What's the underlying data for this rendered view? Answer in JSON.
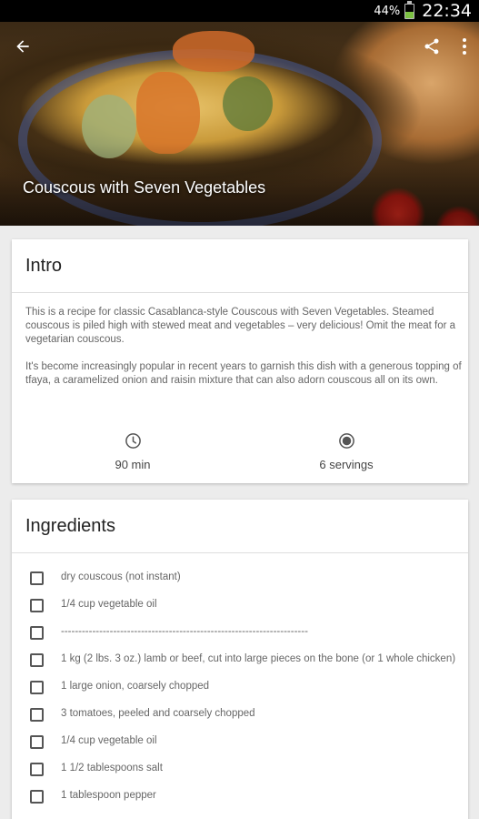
{
  "status_bar": {
    "battery_percent": "44%",
    "battery_level": 0.44,
    "clock": "22:34"
  },
  "header": {
    "title": "Couscous with Seven Vegetables",
    "back_icon": "arrow-back-icon",
    "share_icon": "share-icon",
    "more_icon": "more-vert-icon"
  },
  "intro": {
    "title": "Intro",
    "paragraphs": [
      "This is a recipe for classic Casablanca-style Couscous with Seven Vegetables. Steamed couscous is piled high with stewed meat and vegetables – very delicious! Omit the meat for a vegetarian couscous.",
      "It's become increasingly popular in recent years to garnish this dish with a generous topping of tfaya, a caramelized onion and raisin mixture that can also adorn couscous all on its own."
    ],
    "time": {
      "icon": "clock-icon",
      "label": "90 min"
    },
    "servings": {
      "icon": "servings-icon",
      "label": "6 servings"
    }
  },
  "ingredients": {
    "title": "Ingredients",
    "items": [
      "dry couscous (not instant)",
      "1/4 cup vegetable oil",
      "-----------------------------------------------------------------------",
      "1 kg (2 lbs. 3 oz.) lamb or beef, cut into large pieces on the bone (or 1 whole chicken)",
      "1 large onion, coarsely chopped",
      "3 tomatoes, peeled and coarsely chopped",
      "1/4 cup vegetable oil",
      "1 1/2 tablespoons salt",
      "1 tablespoon pepper"
    ]
  }
}
